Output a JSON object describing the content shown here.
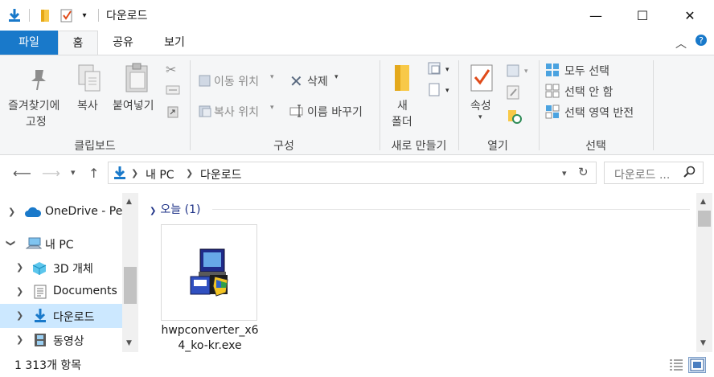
{
  "window": {
    "title": "다운로드",
    "minimize_glyph": "—",
    "maximize_glyph": "☐",
    "close_glyph": "✕"
  },
  "ribbon_tabs": {
    "file": "파일",
    "home": "홈",
    "share": "공유",
    "view": "보기"
  },
  "ribbon": {
    "clipboard": {
      "pin_line1": "즐겨찾기에",
      "pin_line2": "고정",
      "copy": "복사",
      "paste": "붙여넣기",
      "label": "클립보드"
    },
    "organize": {
      "move_to": "이동 위치",
      "copy_to": "복사 위치",
      "delete": "삭제",
      "rename": "이름 바꾸기",
      "label": "구성"
    },
    "new": {
      "new_folder_line1": "새",
      "new_folder_line2": "폴더",
      "label": "새로 만들기"
    },
    "open": {
      "properties": "속성",
      "label": "열기"
    },
    "select": {
      "select_all": "모두 선택",
      "select_none": "선택 안 함",
      "invert_selection": "선택 영역 반전",
      "label": "선택"
    }
  },
  "address": {
    "crumb_root": "내 PC",
    "crumb_current": "다운로드",
    "search_placeholder": "다운로드 ..."
  },
  "nav": {
    "onedrive": "OneDrive - Pe",
    "this_pc": "내 PC",
    "objects_3d": "3D 개체",
    "documents": "Documents",
    "downloads": "다운로드",
    "videos": "동영상"
  },
  "content": {
    "group_header": "오늘 (1)",
    "file_name_line1": "hwpconverter_x6",
    "file_name_line2": "4_ko-kr.exe"
  },
  "status": {
    "item_count": "1 313개 항목"
  },
  "colors": {
    "accent": "#1979ca",
    "selection": "#cce8ff",
    "folder_yellow": "#f8c948",
    "group_header": "#1e3287"
  }
}
